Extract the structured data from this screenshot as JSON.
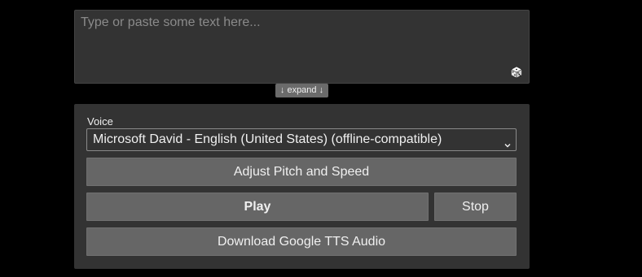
{
  "input": {
    "placeholder": "Type or paste some text here...",
    "value": "",
    "random_icon": "dice-icon"
  },
  "expand_label": "↓ expand ↓",
  "voice": {
    "label": "Voice",
    "selected": "Microsoft David - English (United States) (offline-compatible)",
    "dropdown_icon": "chevron-down-icon"
  },
  "buttons": {
    "pitch_speed": "Adjust Pitch and Speed",
    "play": "Play",
    "stop": "Stop",
    "download": "Download Google TTS Audio"
  },
  "colors": {
    "background": "#000000",
    "panel": "#333333",
    "button": "#666666",
    "text": "#f0f0f0",
    "placeholder": "#8a8a8a"
  }
}
